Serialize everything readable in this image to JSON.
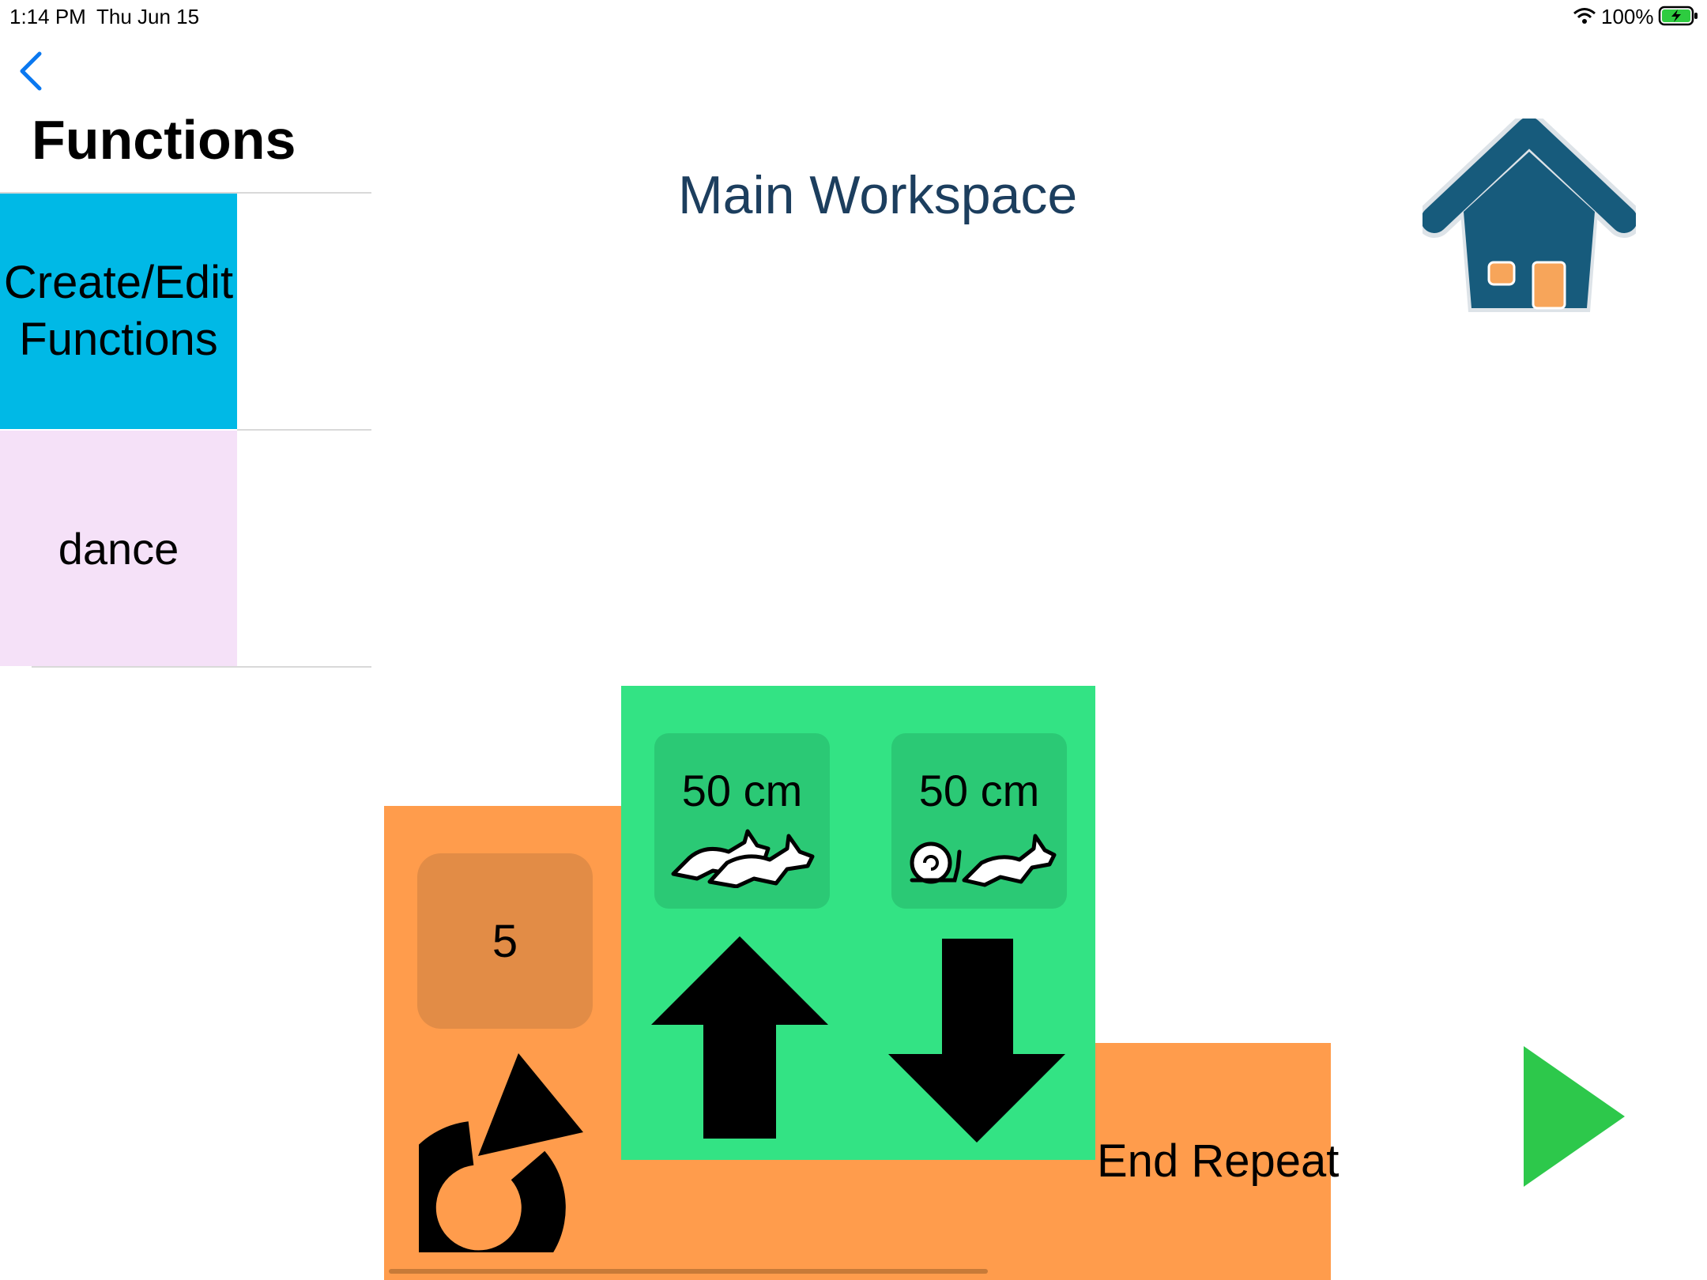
{
  "status_bar": {
    "time": "1:14 PM",
    "date": "Thu Jun 15",
    "battery": "100%",
    "wifi_icon": "wifi-icon",
    "battery_icon": "battery-charging-icon"
  },
  "sidebar": {
    "back_icon": "chevron-left-icon",
    "title": "Functions",
    "items": [
      {
        "line1": "Create/Edit",
        "line2": "Functions",
        "color": "#00b9e6"
      },
      {
        "label": "dance",
        "color": "#f5e1f8"
      }
    ]
  },
  "workspace": {
    "title": "Main Workspace",
    "home_icon": "home-icon",
    "play_icon": "play-icon",
    "repeat_block": {
      "count": "5",
      "repeat_icon": "repeat-icon",
      "end_label": "End Repeat",
      "color": "#ff9c4c"
    },
    "move_block": {
      "color": "#33e384",
      "commands": [
        {
          "distance": "50 cm",
          "speed_icon": "fast-rabbits-icon",
          "direction_icon": "arrow-up-icon"
        },
        {
          "distance": "50 cm",
          "speed_icon": "snail-rabbit-icon",
          "direction_icon": "arrow-down-icon"
        }
      ]
    }
  }
}
